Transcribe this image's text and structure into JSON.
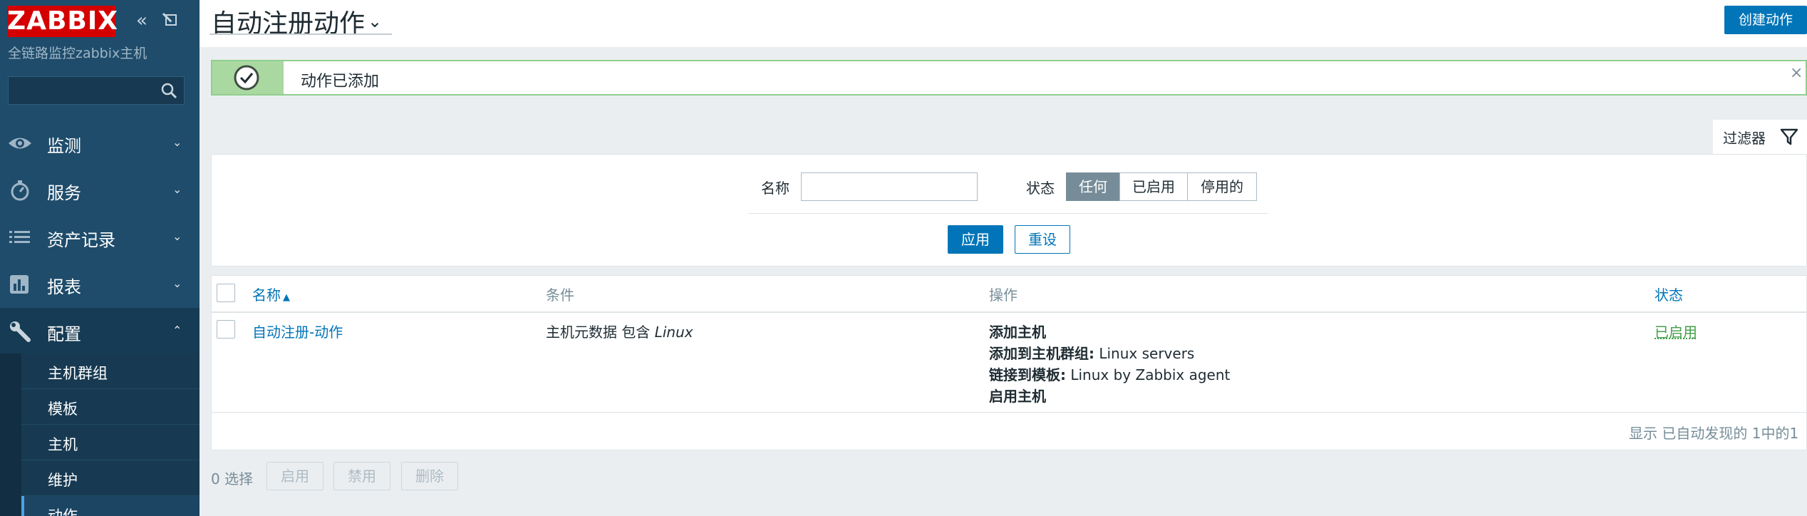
{
  "sidebar": {
    "logo": "ZABBIX",
    "server_name": "全链路监控zabbix主机",
    "search_placeholder": "",
    "menu": [
      {
        "label": "监测",
        "icon": "eye-icon"
      },
      {
        "label": "服务",
        "icon": "stopwatch-icon"
      },
      {
        "label": "资产记录",
        "icon": "list-icon"
      },
      {
        "label": "报表",
        "icon": "bar-chart-icon"
      },
      {
        "label": "配置",
        "icon": "wrench-icon"
      }
    ],
    "submenu": [
      "主机群组",
      "模板",
      "主机",
      "维护",
      "动作"
    ]
  },
  "header": {
    "title": "自动注册动作",
    "create_button": "创建动作"
  },
  "message": {
    "text": "动作已添加"
  },
  "filter": {
    "tab_label": "过滤器",
    "name_label": "名称",
    "name_value": "",
    "status_label": "状态",
    "status_options": [
      "任何",
      "已启用",
      "停用的"
    ],
    "status_selected": "任何",
    "apply_label": "应用",
    "reset_label": "重设"
  },
  "table": {
    "columns": [
      "名称",
      "条件",
      "操作",
      "状态"
    ],
    "rows": [
      {
        "name": "自动注册-动作",
        "condition_prefix": "主机元数据 包含 ",
        "condition_value": "Linux",
        "operations": [
          {
            "label": "添加主机",
            "value": ""
          },
          {
            "label": "添加到主机群组:",
            "value": " Linux servers"
          },
          {
            "label": "链接到模板:",
            "value": " Linux by Zabbix agent"
          },
          {
            "label": "启用主机",
            "value": ""
          }
        ],
        "status": "已启用"
      }
    ],
    "pager": "显示 已自动发现的 1中的1"
  },
  "footer": {
    "selected": "0 选择",
    "buttons": [
      "启用",
      "禁用",
      "删除"
    ]
  },
  "colors": {
    "sidebar_bg": "#1f4c6b",
    "logo_red": "#d40000",
    "primary_blue": "#0275b8",
    "success_green": "#429e47"
  }
}
